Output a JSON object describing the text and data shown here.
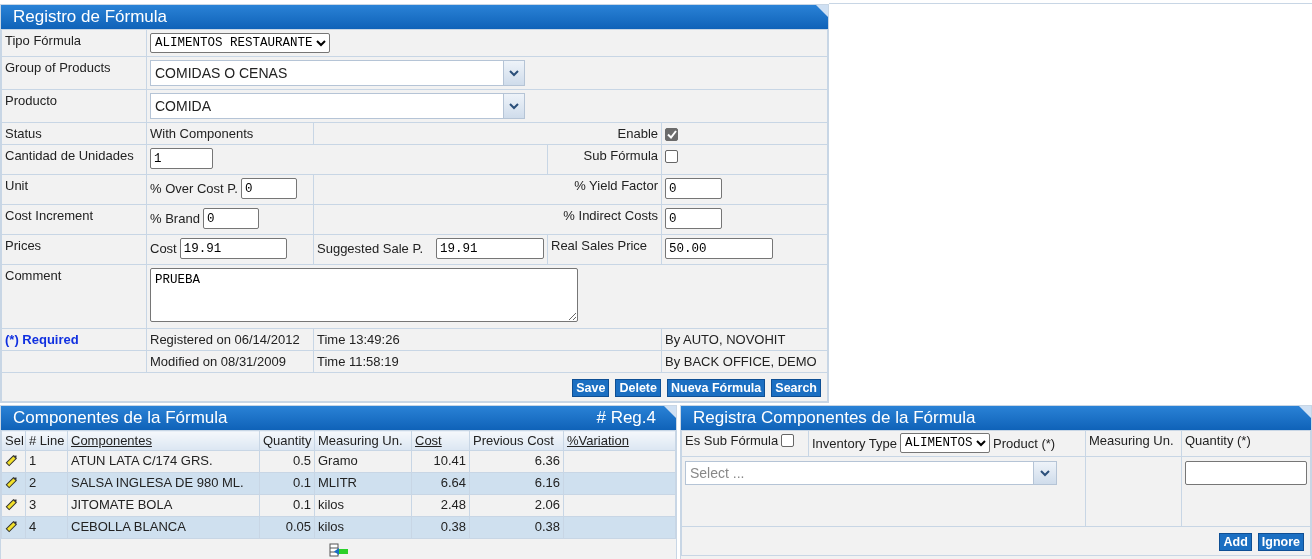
{
  "formula_panel": {
    "title": "Registro de Fórmula",
    "tipo_formula": {
      "label": "Tipo Fórmula",
      "value": "ALIMENTOS RESTAURANTE"
    },
    "group_of_products": {
      "label": "Group of Products",
      "value": "COMIDAS O CENAS"
    },
    "producto": {
      "label": "Producto",
      "value": "COMIDA"
    },
    "status": {
      "label": "Status",
      "value": "With Components"
    },
    "enable": {
      "label": "Enable",
      "checked": true
    },
    "cantidad": {
      "label": "Cantidad de Unidades",
      "value": "1"
    },
    "sub_formula": {
      "label": "Sub Fórmula",
      "checked": false
    },
    "unit": {
      "label": "Unit"
    },
    "over_cost": {
      "label": "% Over Cost P.",
      "value": "0"
    },
    "yield_factor": {
      "label": "% Yield Factor",
      "value": "0"
    },
    "cost_increment": {
      "label": "Cost Increment"
    },
    "brand": {
      "label": "% Brand",
      "value": "0"
    },
    "indirect_costs": {
      "label": "% Indirect Costs",
      "value": "0"
    },
    "prices": {
      "label": "Prices"
    },
    "cost": {
      "label": "Cost",
      "value": "19.91"
    },
    "suggested_sale": {
      "label": "Suggested Sale P.",
      "value": "19.91"
    },
    "real_sales": {
      "label": "Real Sales Price",
      "value": "50.00"
    },
    "comment": {
      "label": "Comment",
      "value": "PRUEBA"
    },
    "required": "(*) Required",
    "audit": [
      {
        "date": "Registered on 06/14/2012",
        "time": "Time 13:49:26",
        "by": "By AUTO, NOVOHIT"
      },
      {
        "date": "Modified on 08/31/2009",
        "time": "Time 11:58:19",
        "by": "By BACK OFFICE, DEMO"
      }
    ],
    "buttons": [
      "Save",
      "Delete",
      "Nueva Fórmula",
      "Search"
    ]
  },
  "components_panel": {
    "title": "Componentes de la Fórmula",
    "count": "# Reg.4",
    "columns": [
      {
        "label": "Sel",
        "kind": "icon",
        "sortable": false
      },
      {
        "label": "# Line",
        "kind": "text",
        "sortable": false
      },
      {
        "label": "Componentes",
        "kind": "text",
        "sortable": true
      },
      {
        "label": "Quantity",
        "kind": "number",
        "sortable": false
      },
      {
        "label": "Measuring Un.",
        "kind": "text",
        "sortable": false
      },
      {
        "label": "Cost",
        "kind": "number",
        "sortable": true
      },
      {
        "label": "Previous Cost",
        "kind": "number",
        "sortable": false
      },
      {
        "label": "%Variation",
        "kind": "text",
        "sortable": true
      }
    ],
    "rows": [
      {
        "cells": [
          "",
          "1",
          "ATUN LATA C/174 GRS.",
          "0.5",
          "Gramo",
          "10.41",
          "6.36",
          ""
        ]
      },
      {
        "cells": [
          "",
          "2",
          "SALSA INGLESA DE 980 ML.",
          "0.1",
          "MLITR",
          "6.64",
          "6.16",
          ""
        ]
      },
      {
        "cells": [
          "",
          "3",
          "JITOMATE BOLA",
          "0.1",
          "kilos",
          "2.48",
          "2.06",
          ""
        ]
      },
      {
        "cells": [
          "",
          "4",
          "CEBOLLA BLANCA",
          "0.05",
          "kilos",
          "0.38",
          "0.38",
          ""
        ]
      }
    ]
  },
  "register_panel": {
    "title": "Registra Componentes de la Fórmula",
    "es_sub_formula": {
      "label": "Es Sub Fórmula",
      "checked": false
    },
    "inventory_type": {
      "label": "Inventory Type",
      "value": "ALIMENTOS"
    },
    "product": {
      "label": "Product (*)",
      "placeholder": "Select ..."
    },
    "measuring_label": "Measuring Un.",
    "quantity_label": "Quantity (*)",
    "buttons": [
      "Add",
      "Ignore"
    ]
  }
}
